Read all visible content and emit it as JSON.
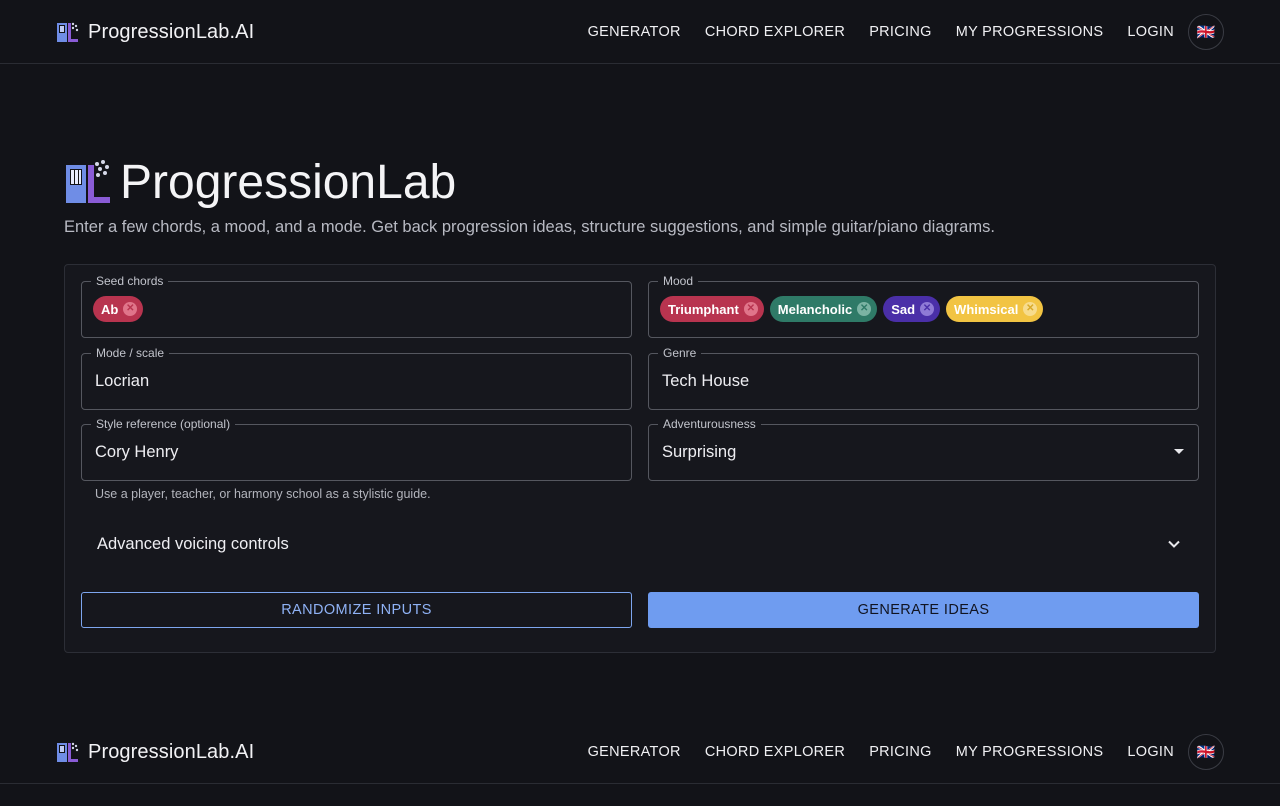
{
  "brand": {
    "name": "ProgressionLab.AI"
  },
  "nav": {
    "links": [
      "GENERATOR",
      "CHORD EXPLORER",
      "PRICING",
      "MY PROGRESSIONS",
      "LOGIN"
    ],
    "language_flag": "🇬🇧"
  },
  "hero": {
    "title": "ProgressionLab",
    "subtitle": "Enter a few chords, a mood, and a mode. Get back progression ideas, structure suggestions, and simple guitar/piano diagrams."
  },
  "form": {
    "seed_chords": {
      "label": "Seed chords",
      "chips": [
        {
          "text": "Ab",
          "color": "#b8344f"
        }
      ]
    },
    "mood": {
      "label": "Mood",
      "chips": [
        {
          "text": "Triumphant",
          "color": "#b8344f"
        },
        {
          "text": "Melancholic",
          "color": "#2f7a67"
        },
        {
          "text": "Sad",
          "color": "#4a2fa8"
        },
        {
          "text": "Whimsical",
          "color": "#f2c443"
        }
      ]
    },
    "mode": {
      "label": "Mode / scale",
      "value": "Locrian"
    },
    "genre": {
      "label": "Genre",
      "value": "Tech House"
    },
    "style": {
      "label": "Style reference (optional)",
      "value": "Cory Henry",
      "helper": "Use a player, teacher, or harmony school as a stylistic guide."
    },
    "adventurousness": {
      "label": "Adventurousness",
      "value": "Surprising"
    },
    "advanced": {
      "label": "Advanced voicing controls"
    },
    "randomize_label": "RANDOMIZE INPUTS",
    "generate_label": "GENERATE IDEAS"
  }
}
